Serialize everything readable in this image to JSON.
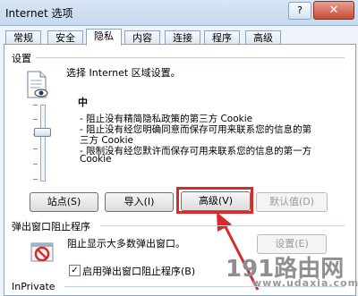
{
  "window": {
    "title": "Internet 选项",
    "help_glyph": "?",
    "close_glyph": "✕"
  },
  "tabs": [
    {
      "label": "常规"
    },
    {
      "label": "安全"
    },
    {
      "label": "隐私"
    },
    {
      "label": "内容"
    },
    {
      "label": "连接"
    },
    {
      "label": "程序"
    },
    {
      "label": "高级"
    }
  ],
  "active_tab": "隐私",
  "settings": {
    "group_label": "设置",
    "zone_prompt": "选择 Internet 区域设置。",
    "level": "中",
    "level_index_from_top": 2,
    "level_count": 6,
    "descriptions": [
      "- 阻止没有精简隐私政策的第三方 Cookie",
      "- 阻止没有经您明确同意而保存可用来联系您的信息的第",
      "三方 Cookie",
      "- 限制没有经您默许而保存可用来联系您的信息的第一方",
      "Cookie"
    ],
    "buttons": {
      "sites": "站点(S)",
      "import": "导入(I)",
      "advanced": "高级(V)",
      "default": "默认值(D)"
    }
  },
  "popup": {
    "group_label": "弹出窗口阻止程序",
    "description": "阻止显示大多数弹出窗口。",
    "settings_button": "设置(E)",
    "enable_checkbox_label": "启用弹出窗口阻止程序(B)",
    "enable_checked": true
  },
  "inprivate": {
    "group_label": "InPrivate"
  },
  "watermark": {
    "brand": "191路由网",
    "url": "www.udaxia.com"
  },
  "colors": {
    "highlight": "#d72a2a",
    "watermark": "#8f8f8f"
  }
}
